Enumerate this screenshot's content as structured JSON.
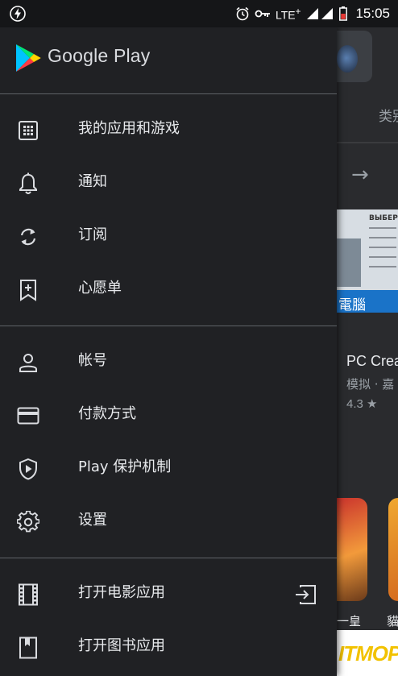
{
  "status_bar": {
    "time": "15:05",
    "network": "LTE",
    "network_suffix": "+"
  },
  "drawer": {
    "brand": "Google Play",
    "sections": [
      {
        "items": [
          {
            "label": "我的应用和游戏",
            "icon": "apps-grid-icon"
          },
          {
            "label": "通知",
            "icon": "bell-icon"
          },
          {
            "label": "订阅",
            "icon": "refresh-icon"
          },
          {
            "label": "心愿单",
            "icon": "bookmark-add-icon"
          }
        ]
      },
      {
        "items": [
          {
            "label": "帐号",
            "icon": "person-icon"
          },
          {
            "label": "付款方式",
            "icon": "credit-card-icon"
          },
          {
            "label": "Play 保护机制",
            "icon": "shield-play-icon"
          },
          {
            "label": "设置",
            "icon": "gear-icon"
          }
        ]
      },
      {
        "items": [
          {
            "label": "打开电影应用",
            "icon": "film-icon",
            "trailing_icon": "exit-app-icon"
          },
          {
            "label": "打开图书应用",
            "icon": "book-icon"
          }
        ]
      }
    ]
  },
  "background_app": {
    "category_tab": "类别",
    "banner_text": "ВЫБЕРИ",
    "banner_label": "電腦",
    "app_title": "PC Crea",
    "app_subtitle": "模拟 · 嘉",
    "app_rating": "4.3 ★",
    "card1_label": "一皇",
    "card2_label": "貓",
    "watermark": "ITMOP"
  },
  "colors": {
    "drawer_bg": "#202124",
    "status_bg": "#151618",
    "text": "#e8eaed",
    "divider": "#5f6368"
  }
}
